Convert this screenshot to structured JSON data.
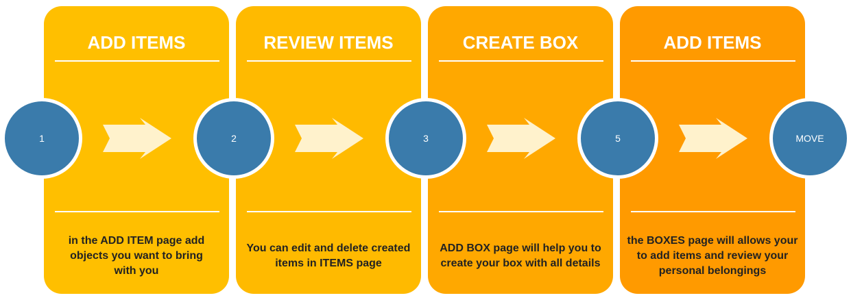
{
  "colors": {
    "panel_1": "#FFBF00",
    "panel_2": "#FFBA00",
    "panel_3": "#FFA800",
    "panel_4": "#FF9A00",
    "circle": "#3A7BAB",
    "arrow": "#FFF2CC"
  },
  "steps": [
    {
      "title": "ADD ITEMS",
      "description": "in the ADD ITEM page add objects you want to bring with you"
    },
    {
      "title": "REVIEW ITEMS",
      "description": "You can edit and delete created items in ITEMS page"
    },
    {
      "title": "CREATE BOX",
      "description": "ADD BOX page will help you to create your box with all details"
    },
    {
      "title": "ADD ITEMS",
      "description": "the BOXES page will allows your to add items and review your personal belongings"
    }
  ],
  "nodes": [
    "1",
    "2",
    "3",
    "5",
    "MOVE"
  ]
}
